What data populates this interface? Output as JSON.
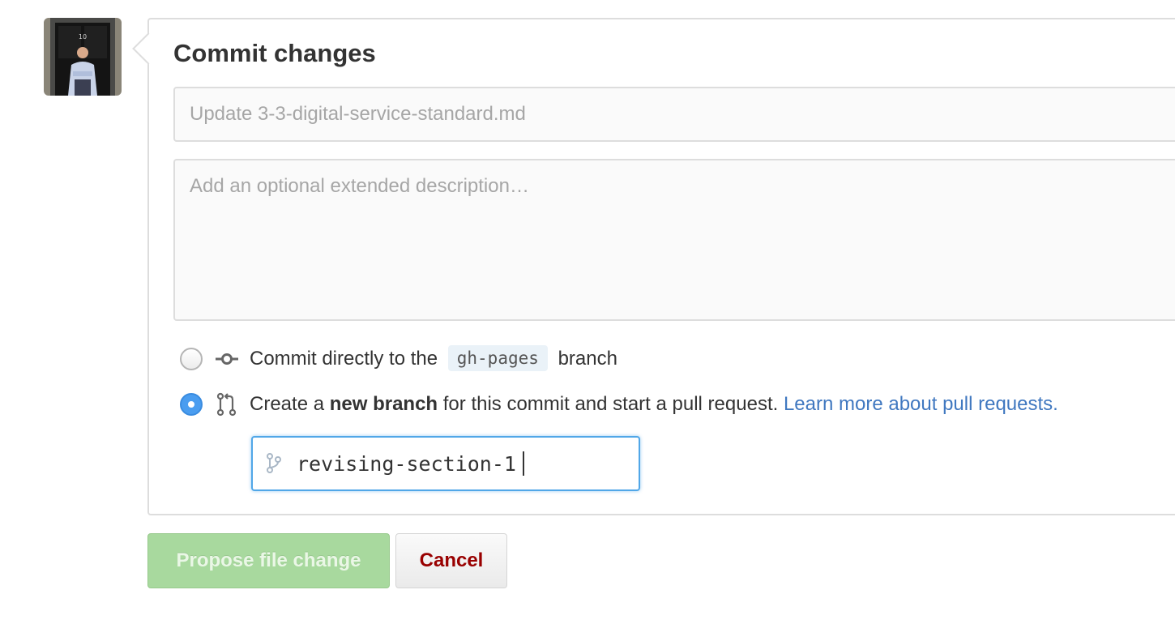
{
  "avatar": {
    "alt": "user-avatar",
    "door_number": "10"
  },
  "commit": {
    "title": "Commit changes",
    "summary_placeholder": "Update 3-3-digital-service-standard.md",
    "description_placeholder": "Add an optional extended description…"
  },
  "options": {
    "direct": {
      "prefix": "Commit directly to the",
      "branch": "gh-pages",
      "suffix": "branch",
      "selected": false
    },
    "new_branch": {
      "prefix": "Create a",
      "bold": "new branch",
      "suffix": "for this commit and start a pull request.",
      "link": "Learn more about pull requests.",
      "selected": true
    }
  },
  "branch_name": {
    "value": "revising-section-1"
  },
  "buttons": {
    "propose": "Propose file change",
    "cancel": "Cancel"
  },
  "colors": {
    "link": "#4078c0",
    "radio_selected": "#4a9df0",
    "propose_disabled": "#a8d99e",
    "cancel_text": "#990000",
    "focus_border": "#51a7e8"
  }
}
